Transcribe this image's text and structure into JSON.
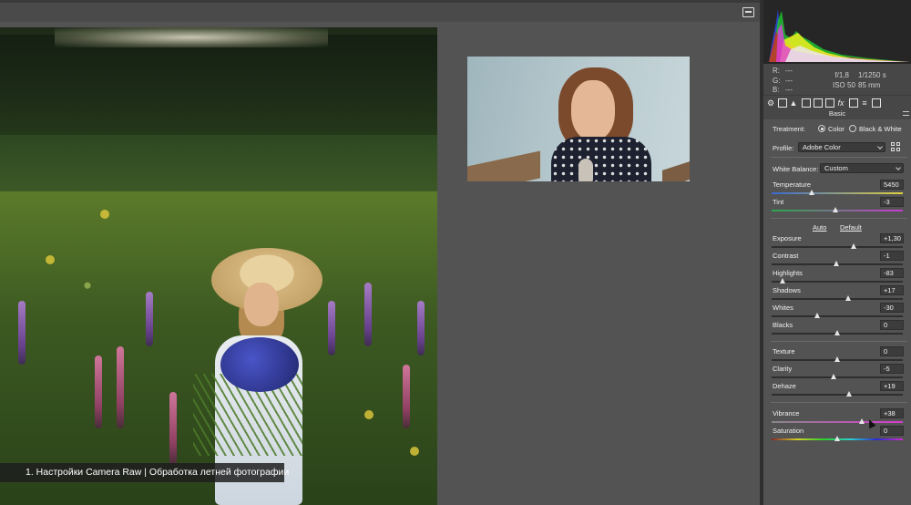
{
  "caption": "1. Настройки Camera Raw | Обработка летней фотографии",
  "info": {
    "r_label": "R:",
    "r_value": "---",
    "g_label": "G:",
    "g_value": "---",
    "b_label": "B:",
    "b_value": "---",
    "aperture": "f/1,8",
    "shutter": "1/1250 s",
    "iso": "ISO 50",
    "focal": "85 mm"
  },
  "panel": {
    "section": "Basic",
    "treatment_label": "Treatment:",
    "treatment_options": [
      "Color",
      "Black & White"
    ],
    "treatment_selected": "Color",
    "profile_label": "Profile:",
    "profile_value": "Adobe Color",
    "white_balance_label": "White Balance:",
    "white_balance_value": "Custom",
    "auto_label": "Auto",
    "default_label": "Default",
    "sliders": [
      {
        "label": "Temperature",
        "value": "5450",
        "min": 2000,
        "max": 50000,
        "num": 5450,
        "scale": "log"
      },
      {
        "label": "Tint",
        "value": "-3",
        "min": -150,
        "max": 150,
        "num": -3
      },
      {
        "label": "Exposure",
        "value": "+1,30",
        "min": -5,
        "max": 5,
        "num": 1.3
      },
      {
        "label": "Contrast",
        "value": "-1",
        "min": -100,
        "max": 100,
        "num": -1
      },
      {
        "label": "Highlights",
        "value": "-83",
        "min": -100,
        "max": 100,
        "num": -83
      },
      {
        "label": "Shadows",
        "value": "+17",
        "min": -100,
        "max": 100,
        "num": 17
      },
      {
        "label": "Whites",
        "value": "-30",
        "min": -100,
        "max": 100,
        "num": -30
      },
      {
        "label": "Blacks",
        "value": "0",
        "min": -100,
        "max": 100,
        "num": 0
      },
      {
        "label": "Texture",
        "value": "0",
        "min": -100,
        "max": 100,
        "num": 0
      },
      {
        "label": "Clarity",
        "value": "-5",
        "min": -100,
        "max": 100,
        "num": -5
      },
      {
        "label": "Dehaze",
        "value": "+19",
        "min": -100,
        "max": 100,
        "num": 19
      },
      {
        "label": "Vibrance",
        "value": "+38",
        "min": -100,
        "max": 100,
        "num": 38
      },
      {
        "label": "Saturation",
        "value": "0",
        "min": -100,
        "max": 100,
        "num": 0
      }
    ]
  },
  "colors": {
    "panel_bg": "#535353",
    "histogram_bg": "#262626",
    "temperature_gradient": [
      "#3a6ad0",
      "#e0d040"
    ],
    "tint_gradient": [
      "#2aa84a",
      "#c83ad0"
    ],
    "vibrance_gradient": [
      "#888888",
      "#d83ad0"
    ]
  }
}
